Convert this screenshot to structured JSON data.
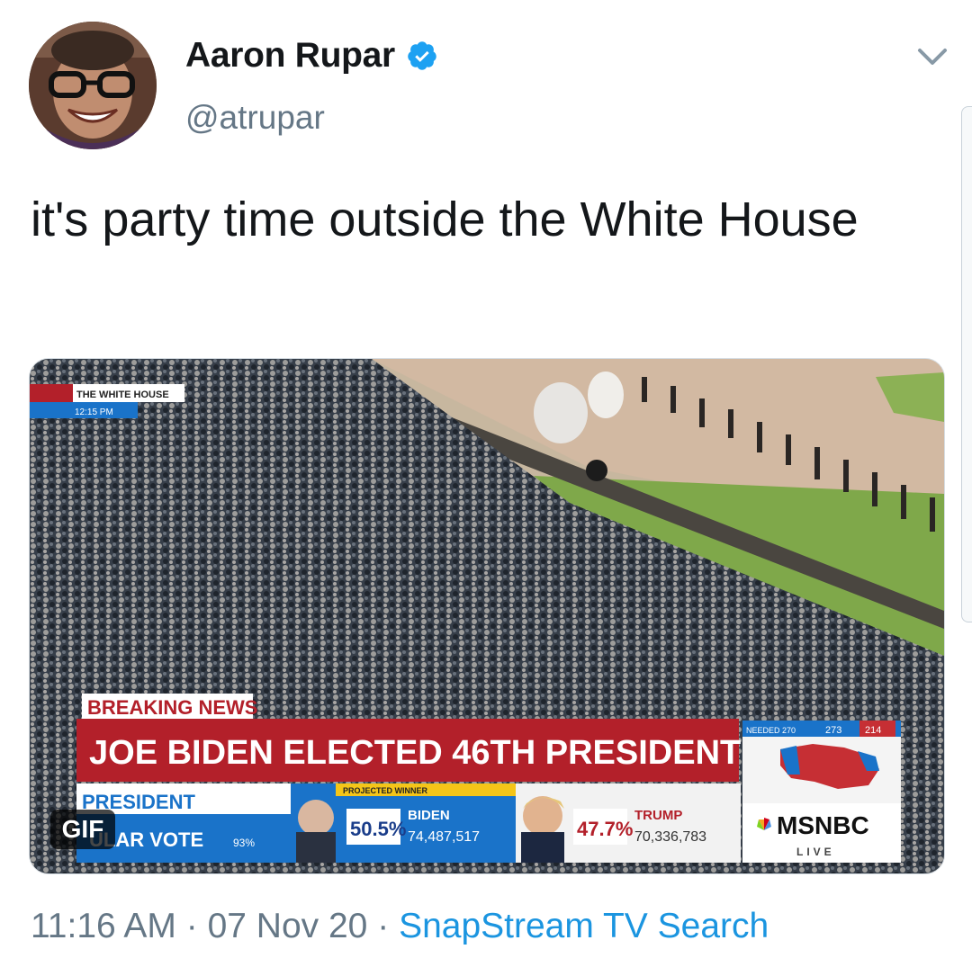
{
  "author": {
    "display_name": "Aaron Rupar",
    "handle": "@atrupar",
    "verified": true
  },
  "tweet": {
    "text": "it's party time outside the White House"
  },
  "media": {
    "badge": "GIF",
    "broadcast": {
      "bug_title": "THE WHITE HOUSE",
      "bug_time": "12:15 PM",
      "breaking_label": "BREAKING NEWS",
      "headline": "JOE BIDEN ELECTED 46TH PRESIDENT",
      "section_title_1": "PRESIDENT",
      "section_title_2": "ULAR VOTE",
      "reporting_pct": "93%",
      "biden_flag": "PROJECTED WINNER",
      "biden_pct": "50.5%",
      "biden_name": "BIDEN",
      "biden_votes": "74,487,517",
      "trump_pct": "47.7%",
      "trump_name": "TRUMP",
      "trump_votes": "70,336,783",
      "map_header": "NEEDED 270",
      "map_biden": "273",
      "map_trump": "214",
      "network": "MSNBC",
      "live": "LIVE"
    }
  },
  "footer": {
    "time": "11:16 AM",
    "separator": "·",
    "date": "07 Nov 20",
    "source": "SnapStream TV Search"
  },
  "colors": {
    "link": "#1b95e0",
    "verified": "#1da1f2",
    "secondary_text": "#657786",
    "headline_red": "#b3202a",
    "vote_blue": "#1a73c9"
  },
  "icons": [
    "verified-badge-icon",
    "chevron-down-icon"
  ]
}
